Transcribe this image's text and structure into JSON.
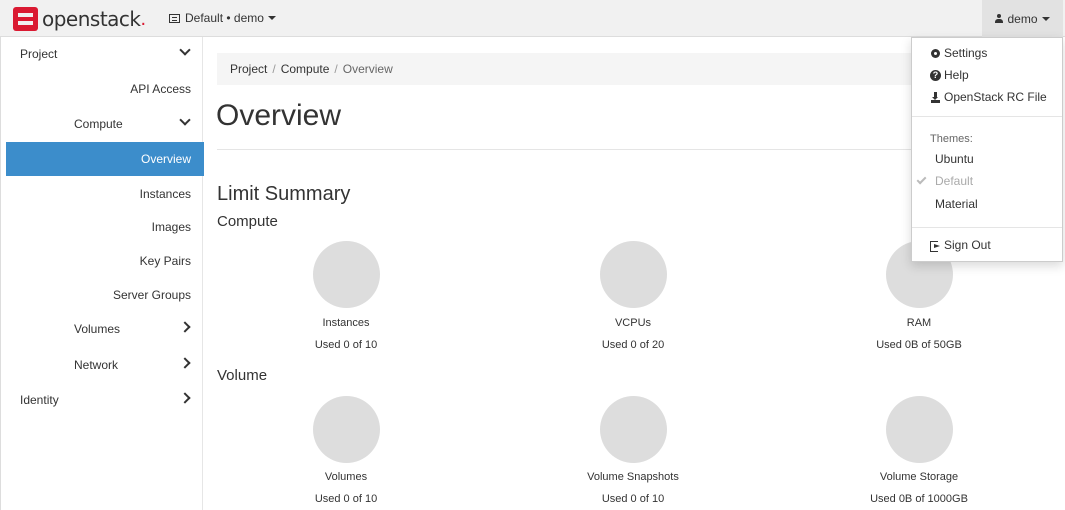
{
  "brand": {
    "name": "openstack",
    "dot": ".",
    "logo_color": "#da1a32"
  },
  "navbar": {
    "project_picker": "Default • demo",
    "user": "demo"
  },
  "sidebar": {
    "project": "Project",
    "api_access": "API Access",
    "compute": "Compute",
    "overview": "Overview",
    "instances": "Instances",
    "images": "Images",
    "key_pairs": "Key Pairs",
    "server_groups": "Server Groups",
    "volumes": "Volumes",
    "network": "Network",
    "identity": "Identity",
    "active_color": "#3c8dcb"
  },
  "breadcrumb": {
    "items": [
      "Project",
      "Compute",
      "Overview"
    ],
    "sep": "/"
  },
  "page": {
    "title": "Overview",
    "limit_summary": "Limit Summary"
  },
  "compute_section": {
    "title": "Compute",
    "charts": [
      {
        "label": "Instances",
        "used": "Used 0 of 10",
        "fraction": 0
      },
      {
        "label": "VCPUs",
        "used": "Used 0 of 20",
        "fraction": 0
      },
      {
        "label": "RAM",
        "used": "Used 0B of 50GB",
        "fraction": 0
      }
    ]
  },
  "volume_section": {
    "title": "Volume",
    "charts": [
      {
        "label": "Volumes",
        "used": "Used 0 of 10",
        "fraction": 0
      },
      {
        "label": "Volume Snapshots",
        "used": "Used 0 of 10",
        "fraction": 0
      },
      {
        "label": "Volume Storage",
        "used": "Used 0B of 1000GB",
        "fraction": 0
      }
    ]
  },
  "user_dropdown": {
    "settings": "Settings",
    "help": "Help",
    "rc_file": "OpenStack RC File",
    "themes_header": "Themes:",
    "theme_ubuntu": "Ubuntu",
    "theme_default": "Default",
    "theme_material": "Material",
    "sign_out": "Sign Out"
  }
}
